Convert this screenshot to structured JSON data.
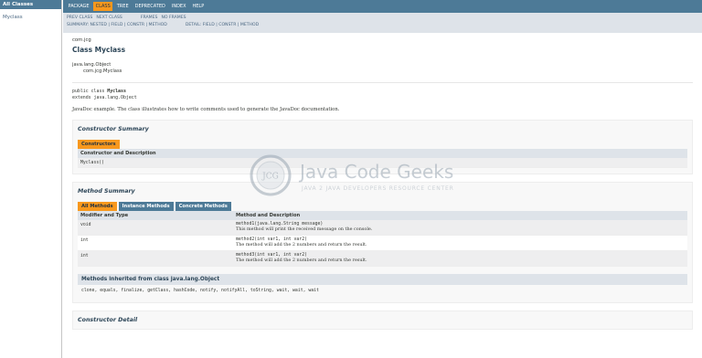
{
  "left_frame": {
    "header": "All Classes",
    "classes": [
      "Myclass"
    ]
  },
  "topnav": {
    "items": [
      "PACKAGE",
      "CLASS",
      "TREE",
      "DEPRECATED",
      "INDEX",
      "HELP"
    ],
    "active": "CLASS"
  },
  "subnav": {
    "prev_class": "PREV CLASS",
    "next_class": "NEXT CLASS",
    "frames": "FRAMES",
    "no_frames": "NO FRAMES",
    "summary_line": "SUMMARY: NESTED | FIELD | CONSTR | METHOD",
    "detail_line": "DETAIL: FIELD | CONSTR | METHOD"
  },
  "header": {
    "package": "com.jcg",
    "class_title": "Class Myclass",
    "inheritance_root": "java.lang.Object",
    "inheritance_child": "com.jcg.Myclass"
  },
  "signature": {
    "line1_prefix": "public class ",
    "line1_name": "Myclass",
    "line2": "extends java.lang.Object"
  },
  "description": "JavaDoc example. The class illustrates how to write comments used to generate the JavaDoc documentation.",
  "constructor_summary": {
    "title": "Constructor Summary",
    "caption": "Constructors",
    "column": "Constructor and Description",
    "rows": [
      "Myclass()"
    ]
  },
  "method_summary": {
    "title": "Method Summary",
    "captions": [
      "All Methods",
      "Instance Methods",
      "Concrete Methods"
    ],
    "columns": [
      "Modifier and Type",
      "Method and Description"
    ],
    "rows": [
      {
        "type": "void",
        "signature": "method1(java.lang.String message)",
        "description": "This method will print the received message on the console."
      },
      {
        "type": "int",
        "signature": "method2(int var1, int var2)",
        "description": "The method will add the 2 numbers and return the result."
      },
      {
        "type": "int",
        "signature": "method3(int var1, int var2)",
        "description": "The method will add the 2 numbers and return the result."
      }
    ]
  },
  "inherited": {
    "title": "Methods inherited from class java.lang.Object",
    "list": "clone, equals, finalize, getClass, hashCode, notify, notifyAll, toString, wait, wait, wait"
  },
  "constructor_detail": {
    "title": "Constructor Detail"
  },
  "watermark": {
    "brand": "Java Code Geeks",
    "tagline": "JAVA 2 JAVA DEVELOPERS RESOURCE CENTER",
    "logo_text": "JCG"
  }
}
